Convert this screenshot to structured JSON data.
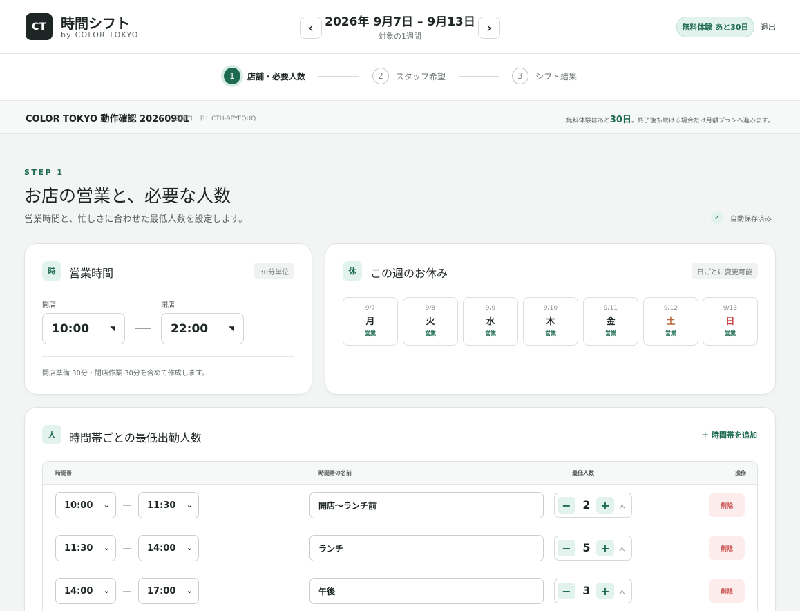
{
  "header": {
    "logo_text": "CT",
    "app_title": "時間シフト",
    "app_subtitle": "by COLOR TOKYO",
    "prev_icon": "‹",
    "next_icon": "›",
    "week_range": "2026年 9月7日 – 9月13日",
    "week_subtitle": "対象の1週間",
    "trial_badge": "無料体験 あと30日",
    "logout_label": "退出"
  },
  "stepper": {
    "steps": [
      {
        "num": "1",
        "label": "店舗・必要人数",
        "active": true
      },
      {
        "num": "2",
        "label": "スタッフ希望",
        "active": false
      },
      {
        "num": "3",
        "label": "シフト結果",
        "active": false
      }
    ]
  },
  "store": {
    "name": "COLOR TOKYO 動作確認 20260901",
    "code": "店舗コード：CTH-9PYFQUQ",
    "trial_note_prefix": "無料体験はあと",
    "trial_days": "30日",
    "trial_note_suffix": "。終了後も続ける場合だけ月額プランへ進みます。"
  },
  "step_heading": {
    "tag": "STEP 1",
    "title": "お店の営業と、必要な人数",
    "description": "営業時間と、忙しさに合わせた最低人数を設定します。",
    "autosave_icon": "✓",
    "autosave_label": "自動保存済み"
  },
  "hours_card": {
    "icon": "時",
    "title": "営業時間",
    "unit_pill": "30分単位",
    "open_label": "開店",
    "open_value": "10:00",
    "close_label": "閉店",
    "close_value": "22:00",
    "caret": "◥",
    "note": "開店準備 30分・閉店作業 30分を含めて作成します。"
  },
  "holiday_card": {
    "icon": "休",
    "title": "この週のお休み",
    "pill": "日ごとに変更可能",
    "days": [
      {
        "date": "9/7",
        "name": "月",
        "status": "営業"
      },
      {
        "date": "9/8",
        "name": "火",
        "status": "営業"
      },
      {
        "date": "9/9",
        "name": "水",
        "status": "営業"
      },
      {
        "date": "9/10",
        "name": "木",
        "status": "営業"
      },
      {
        "date": "9/11",
        "name": "金",
        "status": "営業"
      },
      {
        "date": "9/12",
        "name": "土",
        "status": "営業"
      },
      {
        "date": "9/13",
        "name": "日",
        "status": "営業"
      }
    ]
  },
  "staff_card": {
    "icon": "人",
    "title": "時間帯ごとの最低出勤人数",
    "add_label": "＋ 時間帯を追加",
    "columns": {
      "time": "時間帯",
      "name": "時間帯の名前",
      "min": "最低人数",
      "action": "操作"
    },
    "chevron": "⌄",
    "minus": "−",
    "plus": "+",
    "unit": "人",
    "delete_label": "削除",
    "rows": [
      {
        "start": "10:00",
        "end": "11:30",
        "name": "開店〜ランチ前",
        "count": "2"
      },
      {
        "start": "11:30",
        "end": "14:00",
        "name": "ランチ",
        "count": "5"
      },
      {
        "start": "14:00",
        "end": "17:00",
        "name": "午後",
        "count": "3"
      }
    ]
  },
  "colors": {
    "accent": "#1e6b52",
    "accent_light": "#e2f2ec",
    "danger": "#c94b4b",
    "saturday": "#b86a3c"
  }
}
